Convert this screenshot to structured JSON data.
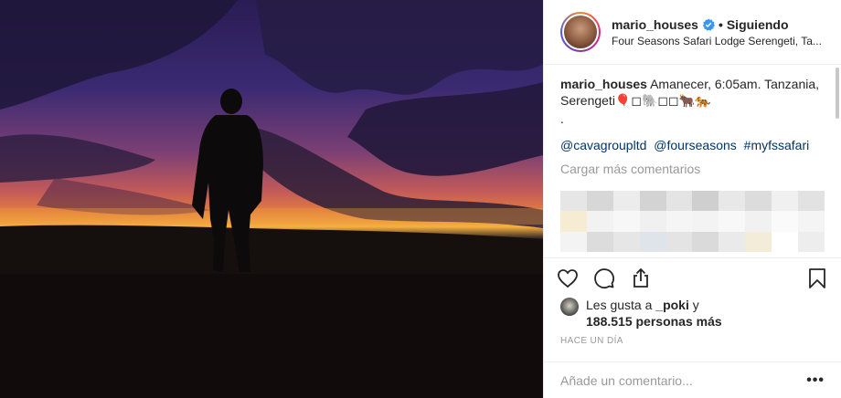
{
  "post": {
    "username": "mario_houses",
    "follow_separator": "•",
    "follow_status": "Siguiendo",
    "location": "Four Seasons Safari Lodge Serengeti, Ta...",
    "caption_text": "Amanecer, 6:05am. Tanzania, Serengeti🎈◻🐘◻◻🐂🐅",
    "caption_dot": ".",
    "tags": [
      "@cavagroupltd",
      "@fourseasons",
      "#myfssafari"
    ],
    "load_more": "Cargar más comentarios",
    "likes_prefix": "Les gusta a",
    "likes_user": "_poki",
    "likes_and": "y",
    "likes_count": "188.515 personas más",
    "time_ago": "HACE UN DÍA",
    "comment_placeholder": "Añade un comentario...",
    "more_options": "•••"
  },
  "colors": {
    "link": "#003569",
    "muted": "#999999",
    "verified": "#3897f0"
  },
  "icons": [
    "verified-icon",
    "heart-icon",
    "comment-icon",
    "share-icon",
    "bookmark-icon"
  ]
}
